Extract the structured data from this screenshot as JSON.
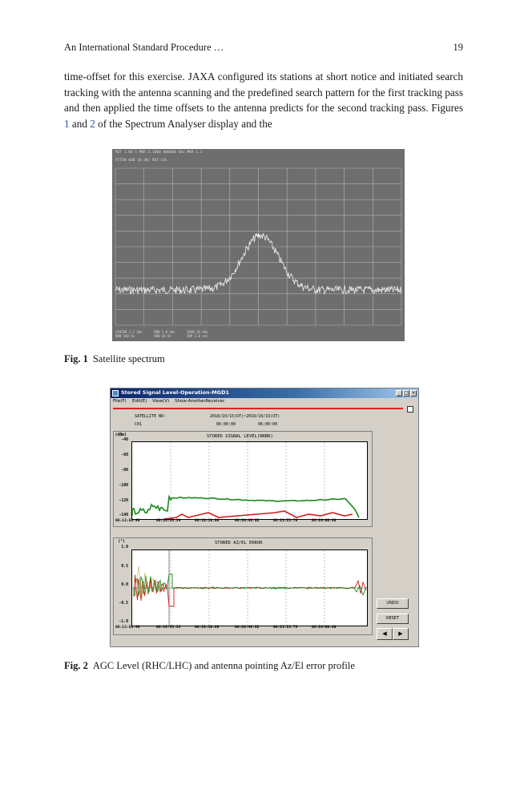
{
  "running_head": {
    "title": "An International Standard Procedure …",
    "page": "19"
  },
  "paragraph": {
    "text_before_ref1": "time-offset for this exercise. JAXA configured its stations at short notice and initiated search tracking with the antenna scanning and the predefined search pattern for the first tracking pass and then applied the time offsets to the antenna predicts for the second tracking pass. Figures ",
    "ref1": "1",
    "text_between": " and ",
    "ref2": "2",
    "text_after": " of the Spectrum Analyser display and the"
  },
  "figure1": {
    "caption_label": "Fig. 1",
    "caption_text": "Satellite spectrum",
    "header": "REF 1.00 1           MKR 2.1000 000000 GHz MKR 1.1",
    "subheader": "ATTEN 0dB   10 dB/   REF LVL",
    "footer": "CENTER 2.1 GHz      RBW 1.0 kHz      SPAN 20 kHz\nRBW 100 Hz          VBW 10 Hz        SWP 1.0 sec",
    "colors": {
      "background": "#6e6e6e",
      "grid": "#d0d0d0",
      "trace": "#f0f0f0"
    }
  },
  "figure2": {
    "caption_label": "Fig. 2",
    "caption_text": "AGC Level (RHC/LHC) and antenna pointing Az/El error profile",
    "window_title": "Stored Signal Level-Operation-MGD1",
    "menu": [
      "File(F)",
      "Edit(E)",
      "View(V)",
      "Show-AnotherReceiver"
    ],
    "satellite_label": "SATELLITE NO:",
    "satellite_value": "C01",
    "time_range": "2018/10/15(UT)~2018/10/15(UT)",
    "time_start": "06:00:00",
    "time_end": "06:00:00",
    "signal_panel": {
      "title": "STORED SIGNAL LEVEL(NRBR)",
      "unit": "(dBm)",
      "yticks": [
        "-40",
        "-60",
        "-80",
        "-100",
        "-120",
        "-140"
      ],
      "xticks": [
        "06:13:56.40",
        "06:15:33.24",
        "06:18:10.08",
        "06:20:46.92",
        "06:23:23.76",
        "06:26:00.60"
      ]
    },
    "error_panel": {
      "title": "STORED AZ/EL ERROR",
      "unit": "(°)",
      "yticks": [
        "1.0",
        "0.5",
        "0.0",
        "-0.5",
        "-1.0"
      ],
      "xticks": [
        "06:13:56.40",
        "06:15:33.24",
        "06:18:10.08",
        "06:20:46.92",
        "06:23:23.76",
        "06:26:00.60"
      ]
    },
    "buttons": {
      "undo": "UNDO",
      "reset": "RESET"
    },
    "colors": {
      "rhc": "#1a8a1a",
      "lhc": "#d22020",
      "title_bar": "#0a246a",
      "az": "#d22020",
      "el": "#1a8a1a"
    }
  }
}
